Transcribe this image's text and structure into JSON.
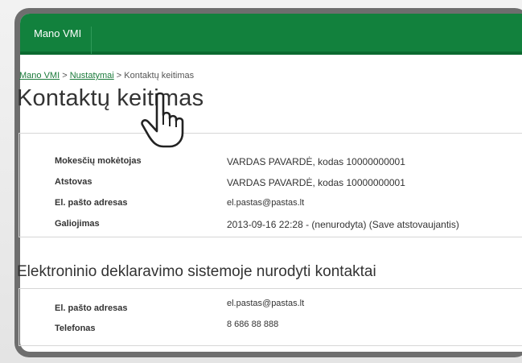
{
  "header": {
    "brand": "Mano VMI"
  },
  "breadcrumb": {
    "items": [
      "Mano VMI",
      "Nustatymai",
      "Kontaktų keitimas"
    ],
    "separator": ">"
  },
  "page_title": "Kontaktų keitimas",
  "taxpayer_info": {
    "rows": [
      {
        "label": "Mokesčių mokėtojas",
        "value": "VARDAS PAVARDĖ, kodas 10000000001"
      },
      {
        "label": "Atstovas",
        "value": "VARDAS PAVARDĖ, kodas 10000000001"
      },
      {
        "label": "El. pašto adresas",
        "value": "el.pastas@pastas.lt"
      },
      {
        "label": "Galiojimas",
        "value": "2013-09-16 22:28 - (nenurodyta) (Save atstovaujantis)"
      }
    ]
  },
  "contacts_section": {
    "title": "Elektroninio deklaravimo sistemoje nurodyti kontaktai",
    "rows": [
      {
        "label": "El. pašto adresas",
        "value": "el.pastas@pastas.lt"
      },
      {
        "label": "Telefonas",
        "value": "8 686 88 888"
      }
    ]
  },
  "cursor_icon": "hand-pointer-icon",
  "colors": {
    "brand_green": "#12813d",
    "frame_gray": "#6e6e6e"
  }
}
